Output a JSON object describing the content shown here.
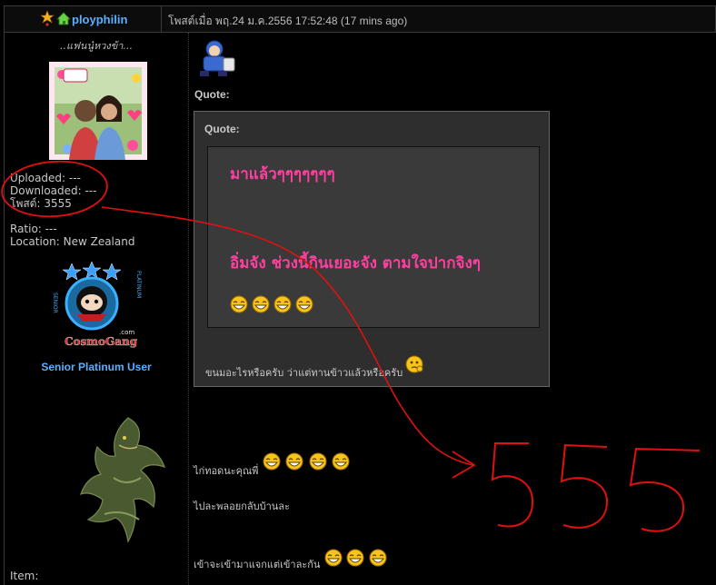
{
  "header": {
    "username": "ployphilin",
    "meta": "โพสต์เมื่อ พฤ.24 ม.ค.2556 17:52:48 (17 mins ago)"
  },
  "sidebar": {
    "tagline": "..แฟนนู๋หวงข้า...",
    "stats": {
      "uploaded": "Uploaded: ---",
      "downloaded": "Downloaded: ---",
      "posts": "โพสต์: 3555",
      "ratio": "Ratio: ---",
      "location": "Location: New Zealand"
    },
    "rank_badge_text": "CosmoGang",
    "rank_badge_side_left": "SENIOR",
    "rank_badge_side_right": "PLATINUM",
    "rank_badge_com": ".com",
    "rank_title": "Senior Platinum User",
    "item_label": "Item:"
  },
  "post": {
    "quote_label_outer": "Quote:",
    "quote_label_inner": "Quote:",
    "inner_line1": "มาแล้วๆๆๆๆๆๆๆ",
    "inner_line2": "อิ่มจัง ช่วงนี้กินเยอะจัง ตามใจปากจิงๆ",
    "outer_reply": "ขนมอะไรหรือครับ ว่าแต่ทานข้าวแล้วหรือครับ",
    "line1": "ไก่ทอดนะคุณพี่",
    "line2": "ไปละพลอยกลับบ้านละ",
    "line3": "เข้าจะเข้ามาแจกแต่เข้าละกัน"
  },
  "annotation": {
    "handwritten": "555",
    "color": "#e01010"
  },
  "colors": {
    "link_blue": "#5ab0ff",
    "pink_text": "#ff3f9f",
    "background": "#000000"
  }
}
